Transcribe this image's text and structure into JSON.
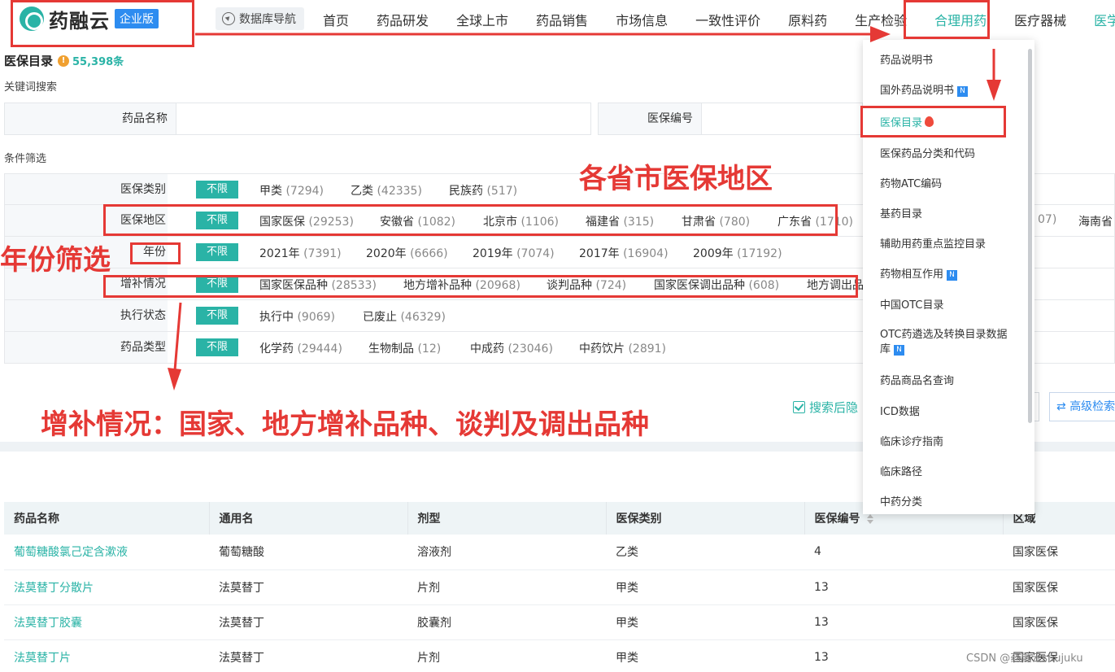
{
  "brand": {
    "name": "药融云",
    "edition": "企业版"
  },
  "nav": {
    "guide_label": "数据库导航",
    "items": [
      "首页",
      "药品研发",
      "全球上市",
      "药品销售",
      "市场信息",
      "一致性评价",
      "原料药",
      "生产检验",
      "合理用药",
      "医疗器械",
      "医学文"
    ]
  },
  "page": {
    "title": "医保目录",
    "count": "55,398条",
    "keyword_label": "关键词搜索",
    "condition_label": "条件筛选"
  },
  "keyword": {
    "fields": [
      {
        "label": "药品名称",
        "value": ""
      },
      {
        "label": "医保编号",
        "value": ""
      }
    ]
  },
  "filters": {
    "no_limit": "不限",
    "rows": [
      {
        "label": "医保类别",
        "options": [
          [
            "甲类",
            "(7294)"
          ],
          [
            "乙类",
            "(42335)"
          ],
          [
            "民族药",
            "(517)"
          ]
        ]
      },
      {
        "label": "医保地区",
        "options": [
          [
            "国家医保",
            "(29253)"
          ],
          [
            "安徽省",
            "(1082)"
          ],
          [
            "北京市",
            "(1106)"
          ],
          [
            "福建省",
            "(315)"
          ],
          [
            "甘肃省",
            "(780)"
          ],
          [
            "广东省",
            "(1710)"
          ],
          [
            "",
            "07)"
          ],
          [
            "海南省",
            ""
          ]
        ]
      },
      {
        "label": "年份",
        "options": [
          [
            "2021年",
            "(7391)"
          ],
          [
            "2020年",
            "(6666)"
          ],
          [
            "2019年",
            "(7074)"
          ],
          [
            "2017年",
            "(16904)"
          ],
          [
            "2009年",
            "(17192)"
          ]
        ]
      },
      {
        "label": "增补情况",
        "options": [
          [
            "国家医保品种",
            "(28533)"
          ],
          [
            "地方增补品种",
            "(20968)"
          ],
          [
            "谈判品种",
            "(724)"
          ],
          [
            "国家医保调出品种",
            "(608)"
          ],
          [
            "地方调出品",
            ""
          ]
        ]
      },
      {
        "label": "执行状态",
        "options": [
          [
            "执行中",
            "(9069)"
          ],
          [
            "已废止",
            "(46329)"
          ]
        ]
      },
      {
        "label": "药品类型",
        "options": [
          [
            "化学药",
            "(29444)"
          ],
          [
            "生物制品",
            "(12)"
          ],
          [
            "中成药",
            "(23046)"
          ],
          [
            "中药饮片",
            "(2891)"
          ]
        ]
      }
    ]
  },
  "search_tools": {
    "checkbox_label": "搜索后隐",
    "advanced_label": "高级检索"
  },
  "table": {
    "headers": [
      "药品名称",
      "通用名",
      "剂型",
      "医保类别",
      "医保编号",
      "区域"
    ],
    "rows": [
      [
        "葡萄糖酸氯己定含漱液",
        "葡萄糖酸",
        "溶液剂",
        "乙类",
        "4",
        "国家医保"
      ],
      [
        "法莫替丁分散片",
        "法莫替丁",
        "片剂",
        "甲类",
        "13",
        "国家医保"
      ],
      [
        "法莫替丁胶囊",
        "法莫替丁",
        "胶囊剂",
        "甲类",
        "13",
        "国家医保"
      ],
      [
        "法莫替丁片",
        "法莫替丁",
        "片剂",
        "甲类",
        "13",
        "国家医保"
      ]
    ]
  },
  "dropdown": {
    "items": [
      {
        "label": "药品说明书",
        "badge": ""
      },
      {
        "label": "国外药品说明书",
        "badge": "N"
      },
      {
        "label": "医保目录",
        "badge": "fire"
      },
      {
        "label": "医保药品分类和代码",
        "badge": ""
      },
      {
        "label": "药物ATC编码",
        "badge": ""
      },
      {
        "label": "基药目录",
        "badge": ""
      },
      {
        "label": "辅助用药重点监控目录",
        "badge": ""
      },
      {
        "label": "药物相互作用",
        "badge": "N"
      },
      {
        "label": "中国OTC目录",
        "badge": ""
      },
      {
        "label": "OTC药遴选及转换目录数据",
        "badge": ""
      },
      {
        "label": "库",
        "badge": "N"
      },
      {
        "label": "药品商品名查询",
        "badge": ""
      },
      {
        "label": "ICD数据",
        "badge": ""
      },
      {
        "label": "临床诊疗指南",
        "badge": ""
      },
      {
        "label": "临床路径",
        "badge": ""
      },
      {
        "label": "中药分类",
        "badge": ""
      }
    ]
  },
  "annotations": {
    "region": "各省市医保地区",
    "year": "年份筛选",
    "supplement": "增补情况：国家、地方增补品种、谈判及调出品种"
  },
  "watermark": "CSDN @药融云shujuku",
  "colors": {
    "accent": "#2ab3a6",
    "annotation_red": "#e53935",
    "badge_blue": "#2d8cf0"
  }
}
